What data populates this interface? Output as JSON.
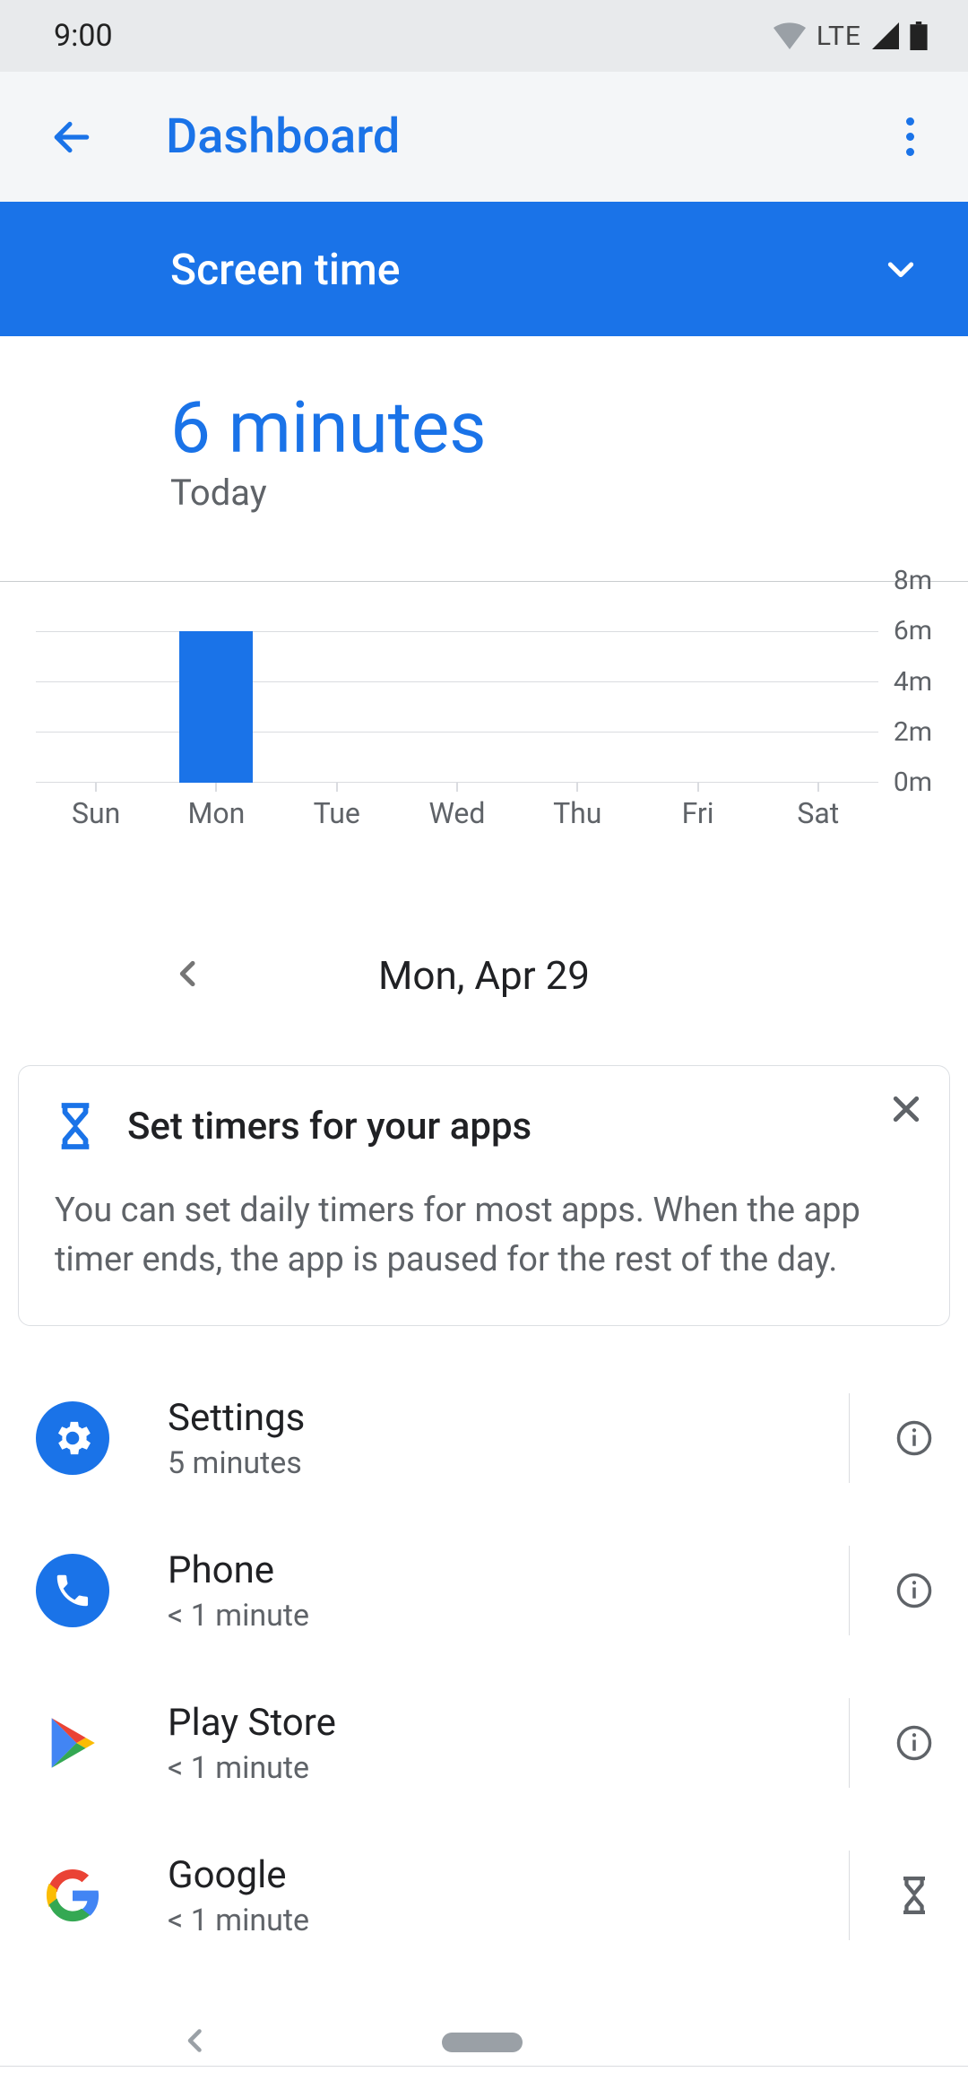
{
  "status": {
    "time": "9:00",
    "network": "LTE"
  },
  "header": {
    "title": "Dashboard"
  },
  "category": {
    "label": "Screen time"
  },
  "summary": {
    "value": "6 minutes",
    "period": "Today"
  },
  "chart_data": {
    "type": "bar",
    "categories": [
      "Sun",
      "Mon",
      "Tue",
      "Wed",
      "Thu",
      "Fri",
      "Sat"
    ],
    "values": [
      0,
      6,
      0,
      0,
      0,
      0,
      0
    ],
    "y_ticks": [
      "8m",
      "6m",
      "4m",
      "2m",
      "0m"
    ],
    "ylim": [
      0,
      8
    ],
    "ylabel": "minutes"
  },
  "date_nav": {
    "label": "Mon, Apr 29"
  },
  "tip": {
    "title": "Set timers for your apps",
    "body": "You can set daily timers for most apps. When the app timer ends, the app is paused for the rest of the day."
  },
  "apps": [
    {
      "name": "Settings",
      "duration": "5 minutes",
      "action": "info",
      "icon": "settings"
    },
    {
      "name": "Phone",
      "duration": "< 1 minute",
      "action": "info",
      "icon": "phone"
    },
    {
      "name": "Play Store",
      "duration": "< 1 minute",
      "action": "info",
      "icon": "play"
    },
    {
      "name": "Google",
      "duration": "< 1 minute",
      "action": "timer",
      "icon": "google"
    }
  ]
}
